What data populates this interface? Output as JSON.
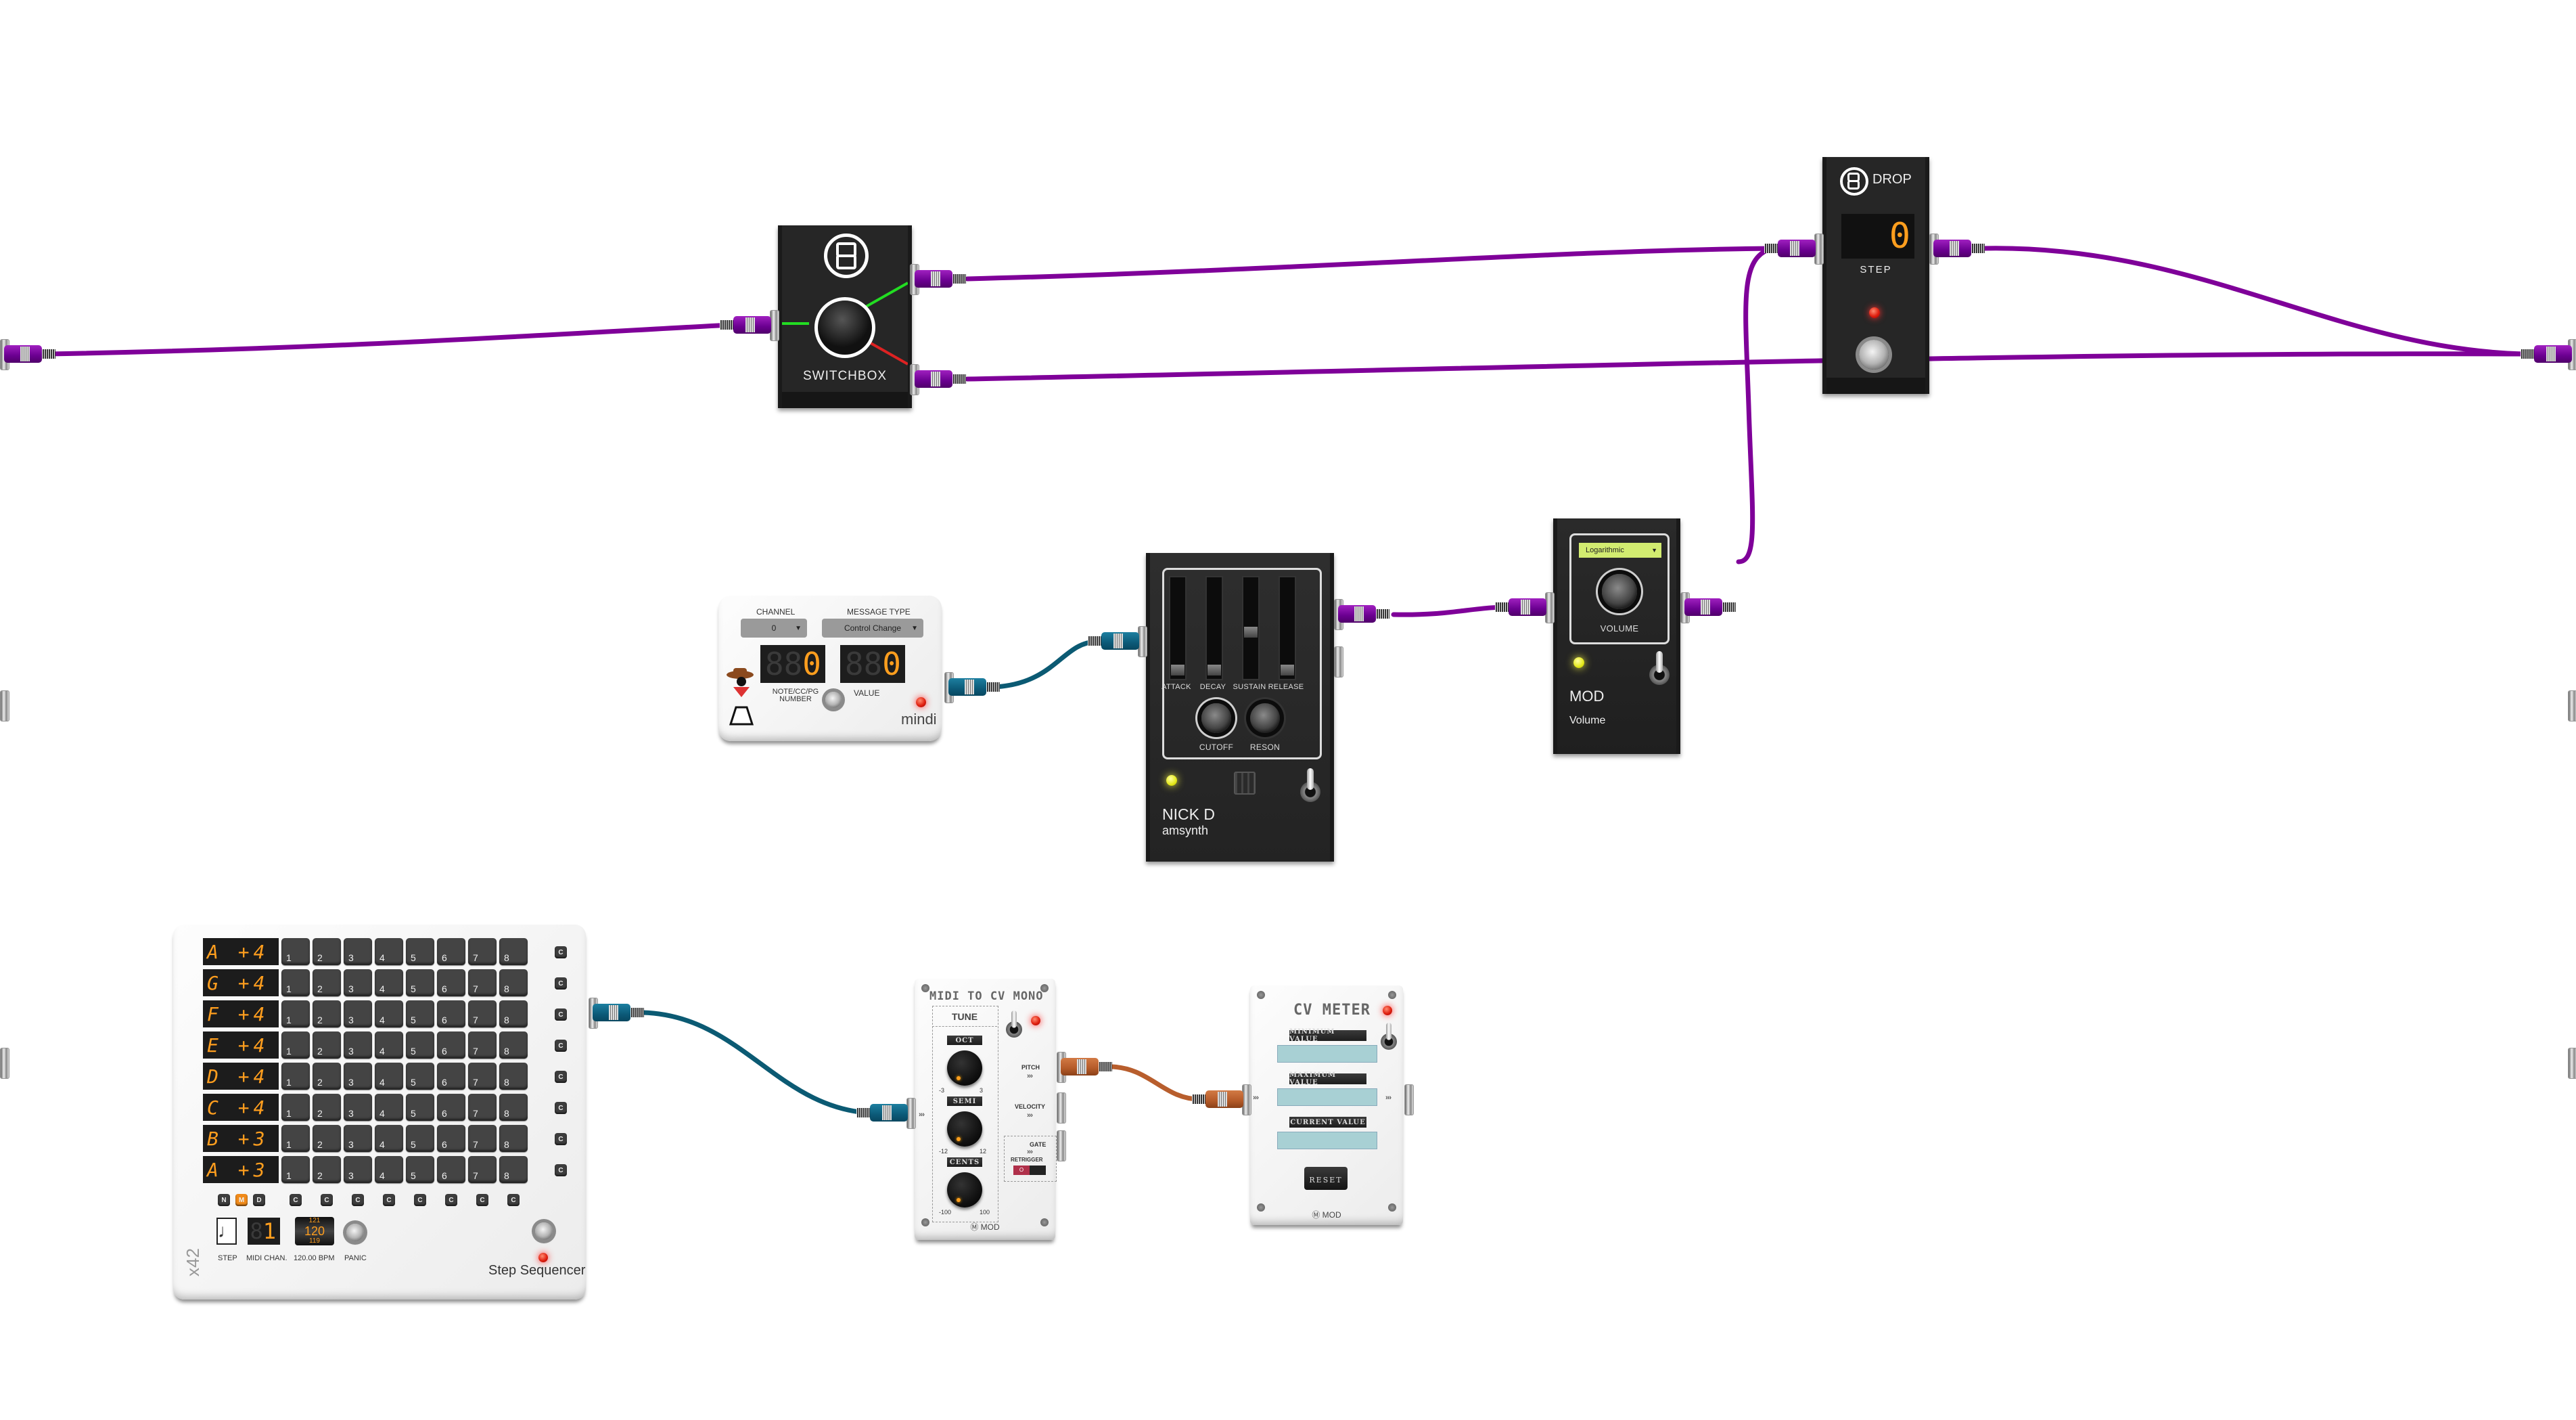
{
  "canvas": {
    "background": "#ffffff"
  },
  "cable_colors": {
    "audio": "#7f0099",
    "midi": "#0b5a73",
    "cv": "#b85e2d"
  },
  "system_ports": {
    "inputs": [
      "capture-1",
      "capture-2",
      "capture-midi"
    ],
    "outputs": [
      "playback-1",
      "playback-2",
      "playback-midi"
    ]
  },
  "switchbox": {
    "name": "SWITCHBOX",
    "selected_output": 1,
    "output_colors": {
      "active": "#22dd22",
      "inactive": "#dd2222"
    }
  },
  "drop": {
    "name": "DROP",
    "step_value": "0",
    "step_label": "STEP"
  },
  "mindi": {
    "brand": "mindi",
    "channel_label": "CHANNEL",
    "channel_value": "0",
    "message_type_label": "MESSAGE TYPE",
    "message_type_value": "Control Change",
    "note_number_label": "NOTE/CC/PG NUMBER",
    "note_number_value": "0",
    "value_label": "VALUE",
    "value_value": "0"
  },
  "amsynth": {
    "brand": "NICK D",
    "name": "amsynth",
    "sliders": [
      {
        "label": "ATTACK",
        "level": 0.02
      },
      {
        "label": "DECAY",
        "level": 0.02
      },
      {
        "label": "SUSTAIN",
        "level": 0.45
      },
      {
        "label": "RELEASE",
        "level": 0.02
      }
    ],
    "knobs": [
      {
        "label": "CUTOFF"
      },
      {
        "label": "RESON"
      }
    ]
  },
  "volume": {
    "brand": "MOD",
    "name": "Volume",
    "mode_value": "Logarithmic",
    "knob_label": "VOLUME"
  },
  "step_sequencer": {
    "brand": "x42",
    "name": "Step Sequencer",
    "rows": [
      {
        "note": "A +4"
      },
      {
        "note": "G +4"
      },
      {
        "note": "F +4"
      },
      {
        "note": "E +4"
      },
      {
        "note": "D +4"
      },
      {
        "note": "C +4"
      },
      {
        "note": "B +3"
      },
      {
        "note": "A +3"
      }
    ],
    "steps": [
      "1",
      "2",
      "3",
      "4",
      "5",
      "6",
      "7",
      "8"
    ],
    "clear_label": "C",
    "mode_buttons": [
      "N",
      "M",
      "D"
    ],
    "active_mode": "M",
    "step_label": "STEP",
    "midi_chan_label": "MIDI CHAN.",
    "midi_chan_value": "1",
    "bpm_above": "121",
    "bpm_value": "120",
    "bpm_below": "119",
    "bpm_label": "120.00 BPM",
    "panic_label": "PANIC"
  },
  "midi_to_cv": {
    "title": "MIDI TO CV MONO",
    "tune_label": "TUNE",
    "knobs": [
      {
        "label": "OCT",
        "min": "-3",
        "max": "3"
      },
      {
        "label": "SEMI",
        "min": "-12",
        "max": "12"
      },
      {
        "label": "CENTS",
        "min": "-100",
        "max": "100"
      }
    ],
    "outputs": [
      "PITCH",
      "VELOCITY",
      "GATE"
    ],
    "retrigger_label": "RETRIGGER",
    "retrigger_value": "O",
    "arrows": "›››",
    "maker": "MOD"
  },
  "cv_meter": {
    "title": "CV METER",
    "fields": [
      {
        "label": "MINIMUM VALUE",
        "value": ""
      },
      {
        "label": "MAXIMUM VALUE",
        "value": ""
      },
      {
        "label": "CURRENT VALUE",
        "value": ""
      }
    ],
    "reset_label": "RESET",
    "arrows": "›››",
    "maker": "MOD"
  }
}
